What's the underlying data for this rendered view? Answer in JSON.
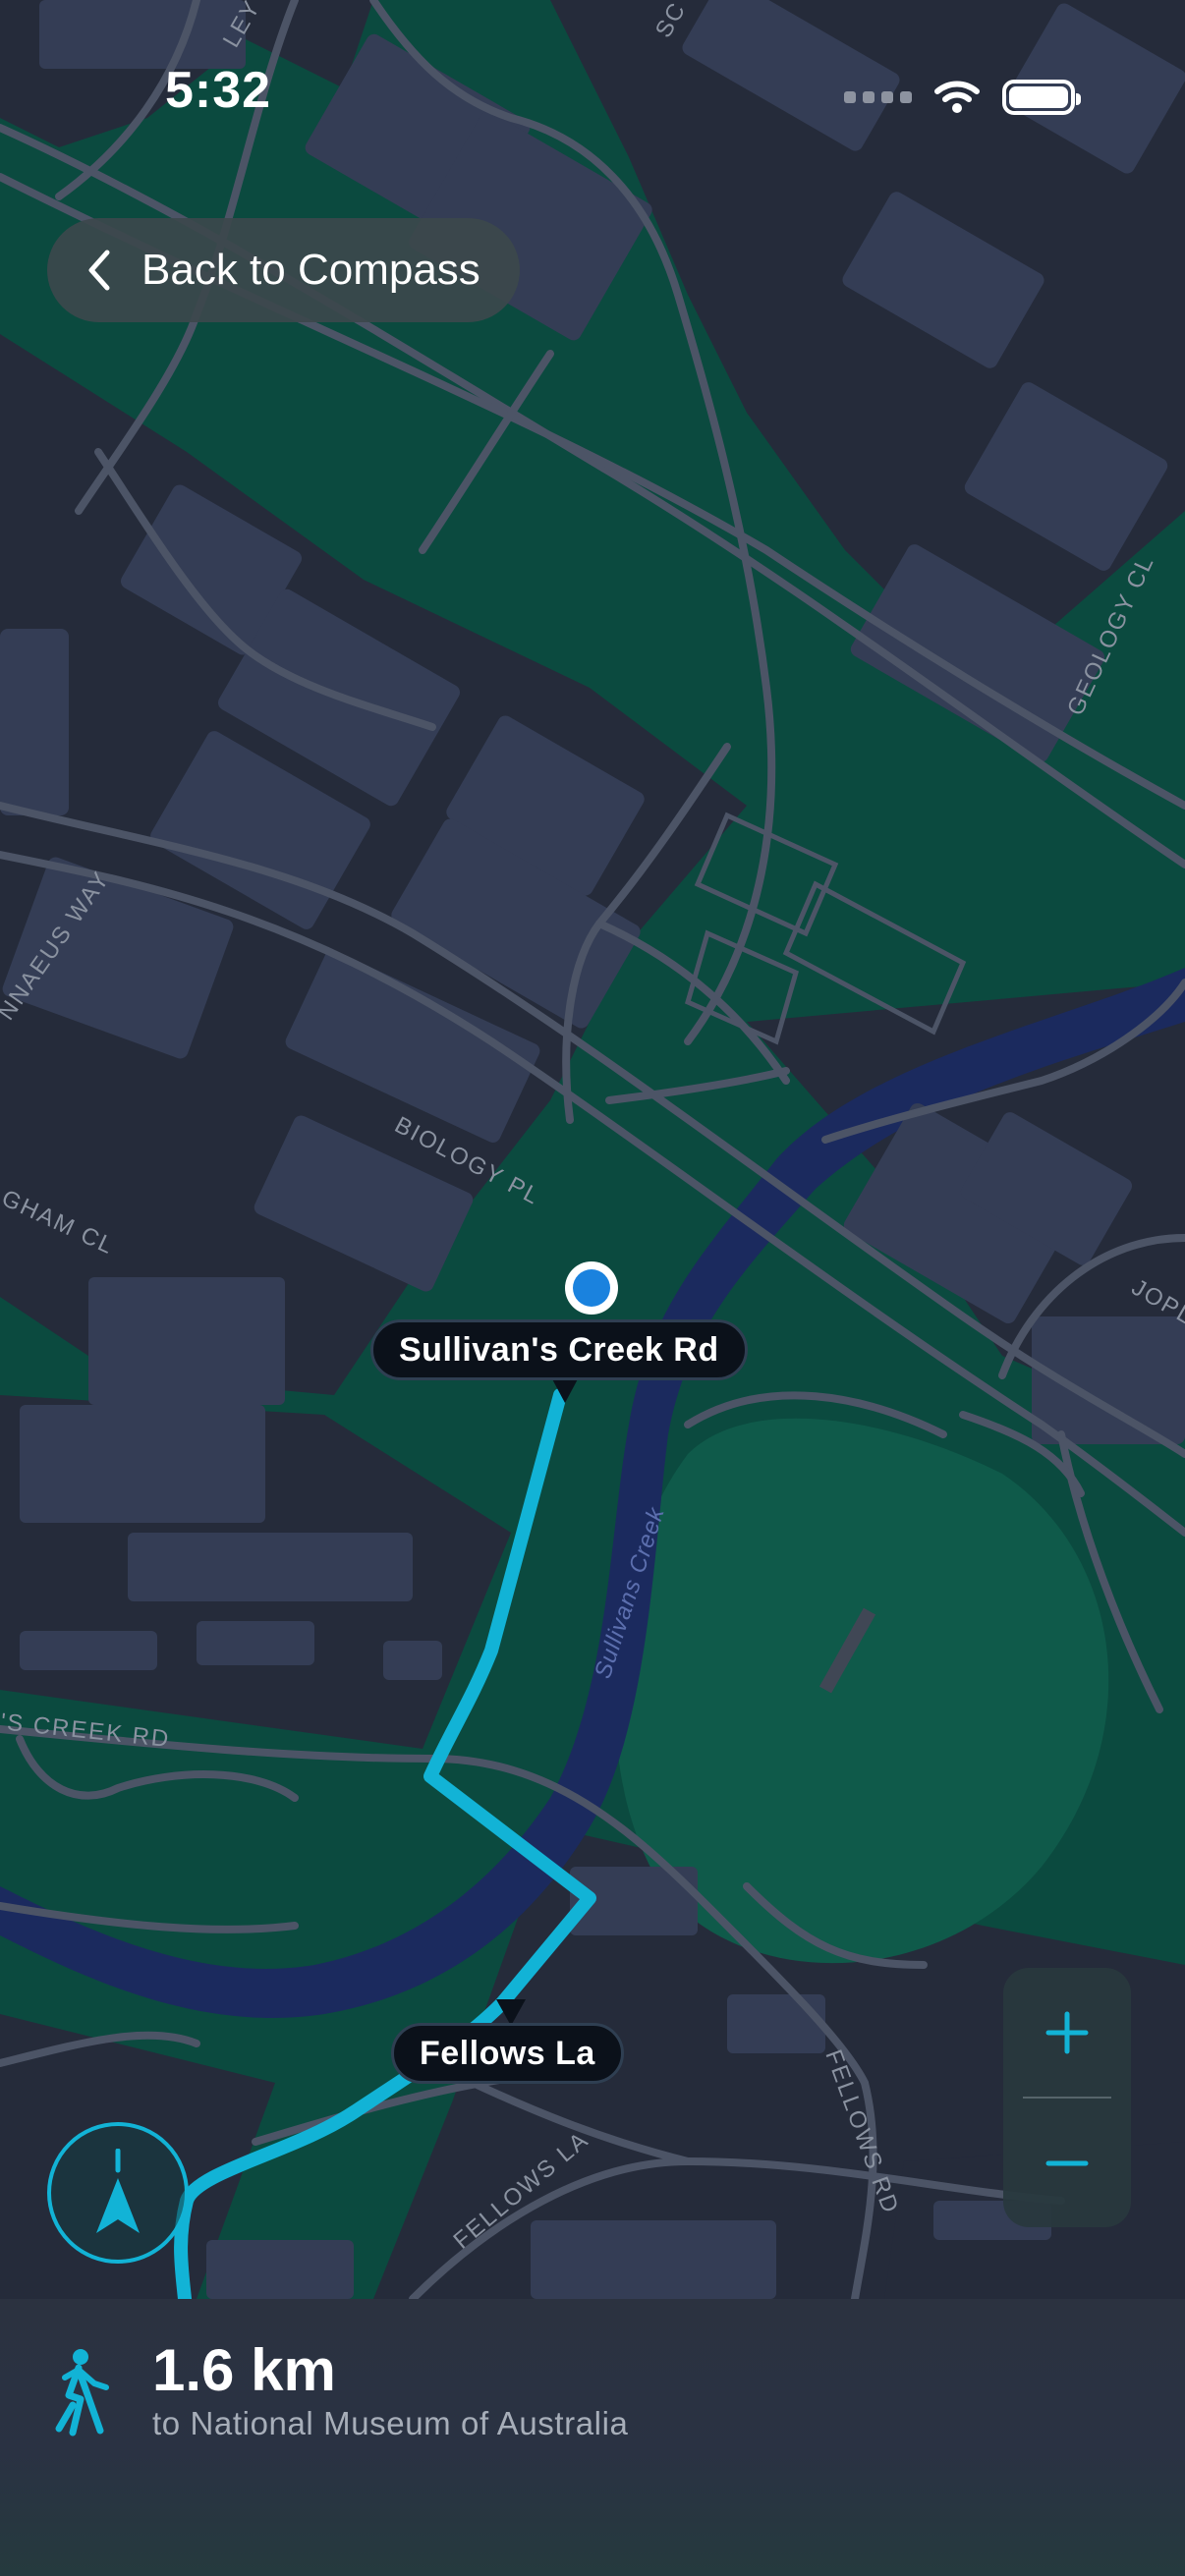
{
  "status_bar": {
    "time": "5:32"
  },
  "navigation": {
    "back_label": "Back to Compass"
  },
  "map": {
    "street_labels": {
      "current": "Sullivan's Creek Rd",
      "next": "Fellows La"
    },
    "basemap_labels": {
      "road_top": "LEY RD",
      "road_top_right": "SC",
      "geology": "GEOLOGY CL",
      "linnaeus": "NNAEUS WAY",
      "biology": "BIOLOGY PL",
      "gham": "GHAM CL",
      "jopl": "JOPL",
      "creek_rd": "'S CREEK RD",
      "creek": "Sullivans Creek",
      "fellows_la": "FELLOWS LA",
      "fellows_rd": "FELLOWS RD"
    },
    "colors": {
      "park": "#0b4a3f",
      "blocks": "#343d55",
      "roads": "#4c5466",
      "water": "#1b2a5e",
      "route": "#12b3d6",
      "user_location": "#1a82de"
    }
  },
  "controls": {
    "compass_icon": "navigation-arrow-icon",
    "zoom_in_icon": "plus-icon",
    "zoom_out_icon": "minus-icon"
  },
  "route_summary": {
    "icon": "walking-person-icon",
    "distance": "1.6 km",
    "destination": "to National Museum of Australia"
  }
}
